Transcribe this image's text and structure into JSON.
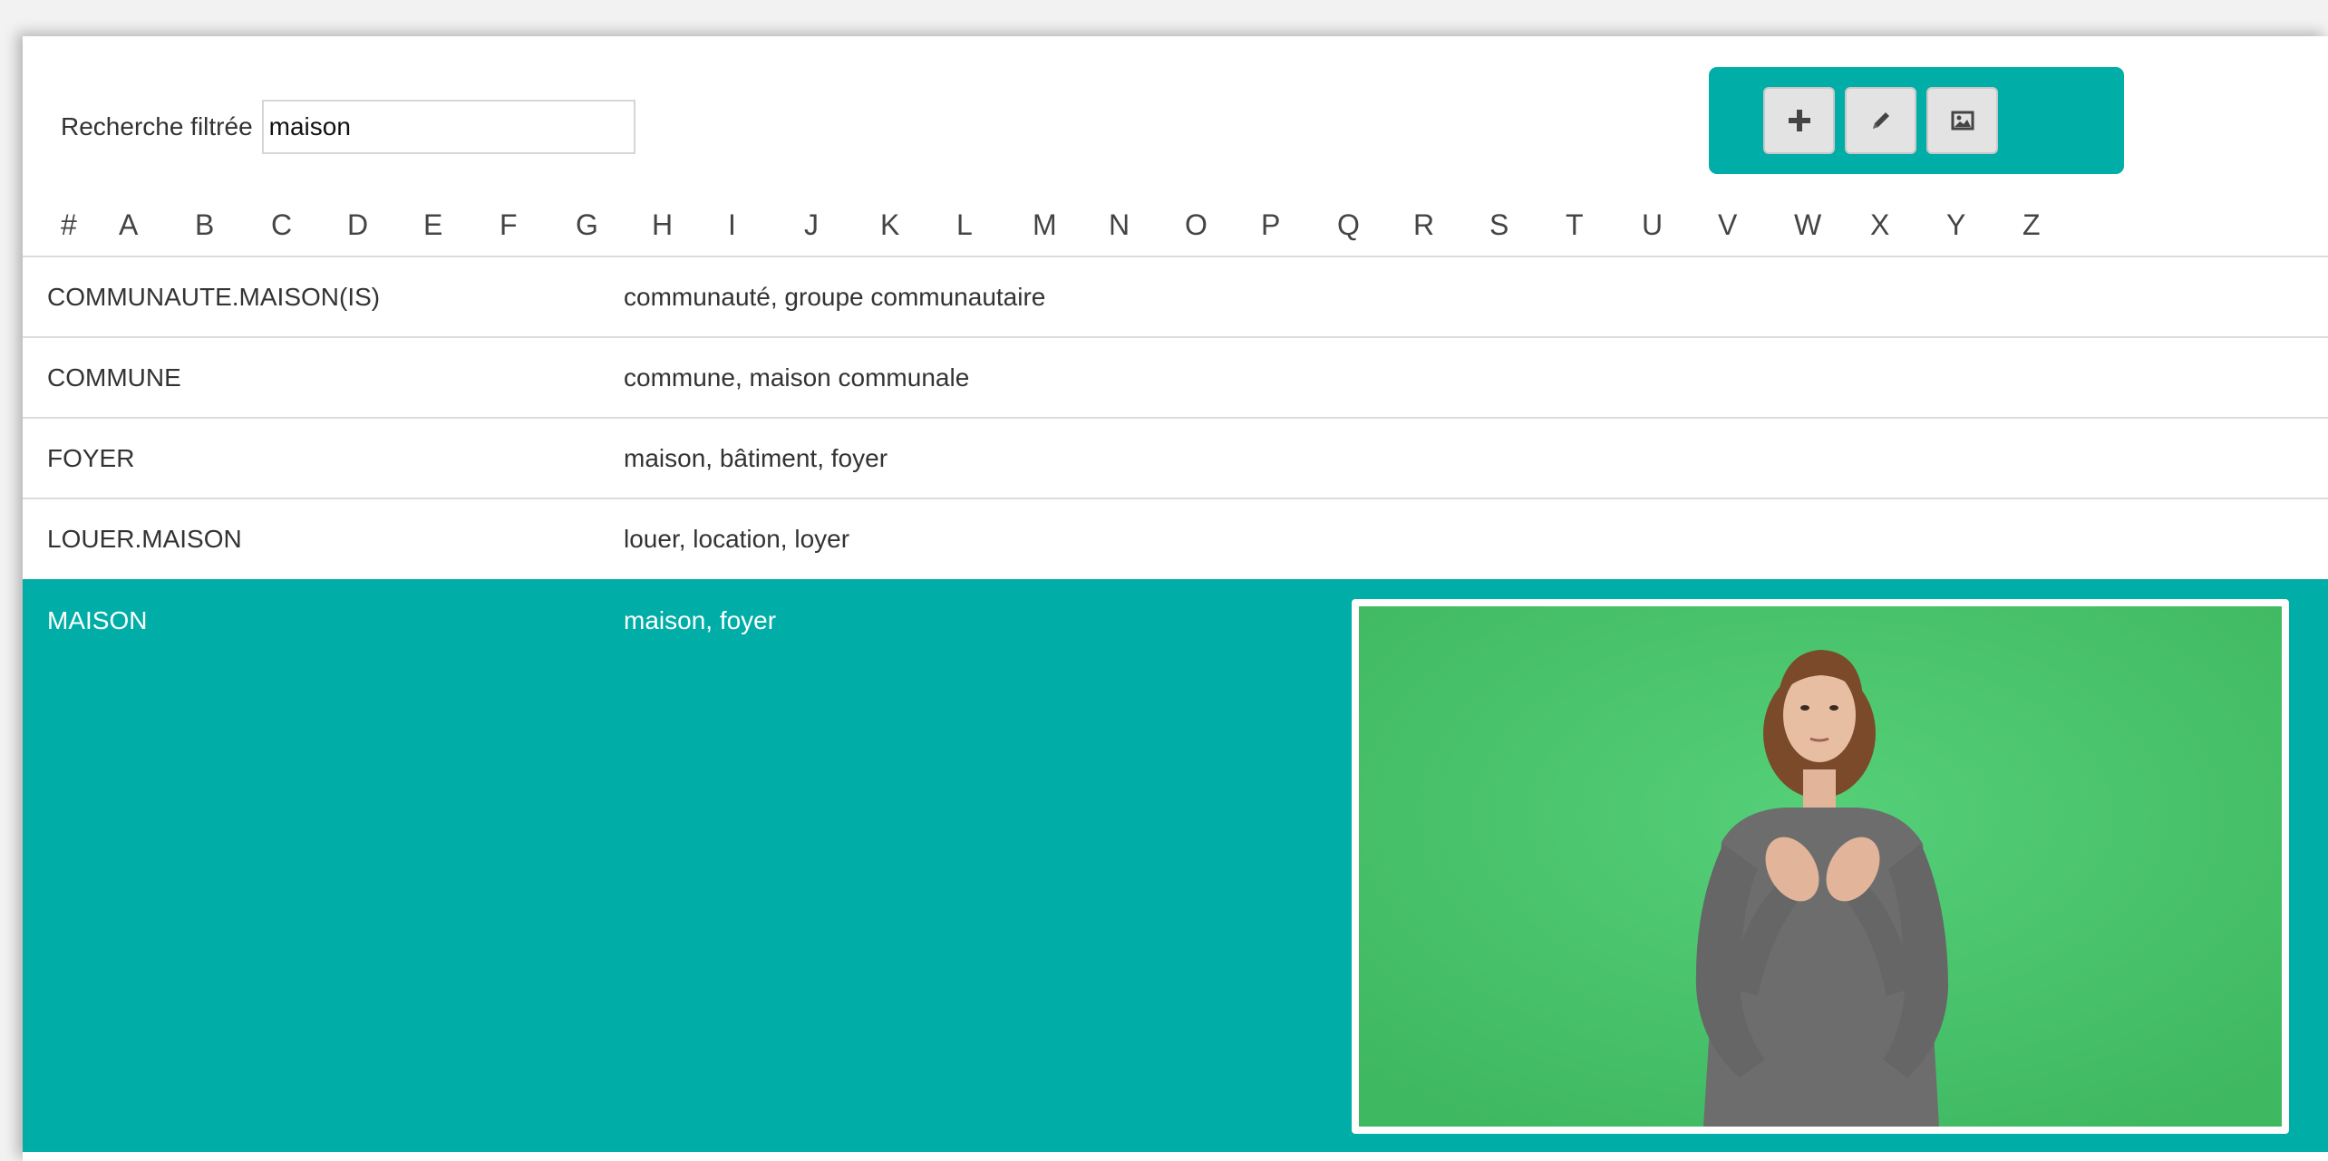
{
  "search": {
    "label": "Recherche filtrée",
    "value": "maison"
  },
  "toolbar": {
    "buttons": [
      {
        "icon": "plus-icon"
      },
      {
        "icon": "pencil-icon"
      },
      {
        "icon": "image-icon"
      }
    ],
    "color": "#00ada7"
  },
  "alphabet": [
    "#",
    "A",
    "B",
    "C",
    "D",
    "E",
    "F",
    "G",
    "H",
    "I",
    "J",
    "K",
    "L",
    "M",
    "N",
    "O",
    "P",
    "Q",
    "R",
    "S",
    "T",
    "U",
    "V",
    "W",
    "X",
    "Y",
    "Z"
  ],
  "entries": [
    {
      "gloss": "COMMUNAUTE.MAISON(IS)",
      "translation": "communauté, groupe communautaire"
    },
    {
      "gloss": "COMMUNE",
      "translation": "commune, maison communale"
    },
    {
      "gloss": "FOYER",
      "translation": "maison, bâtiment, foyer"
    },
    {
      "gloss": "LOUER.MAISON",
      "translation": "louer, location, loyer"
    },
    {
      "gloss": "MAISON",
      "translation": "maison, foyer",
      "selected": true
    }
  ],
  "colors": {
    "accent": "#00ada7",
    "video_background": "#47c46b"
  }
}
